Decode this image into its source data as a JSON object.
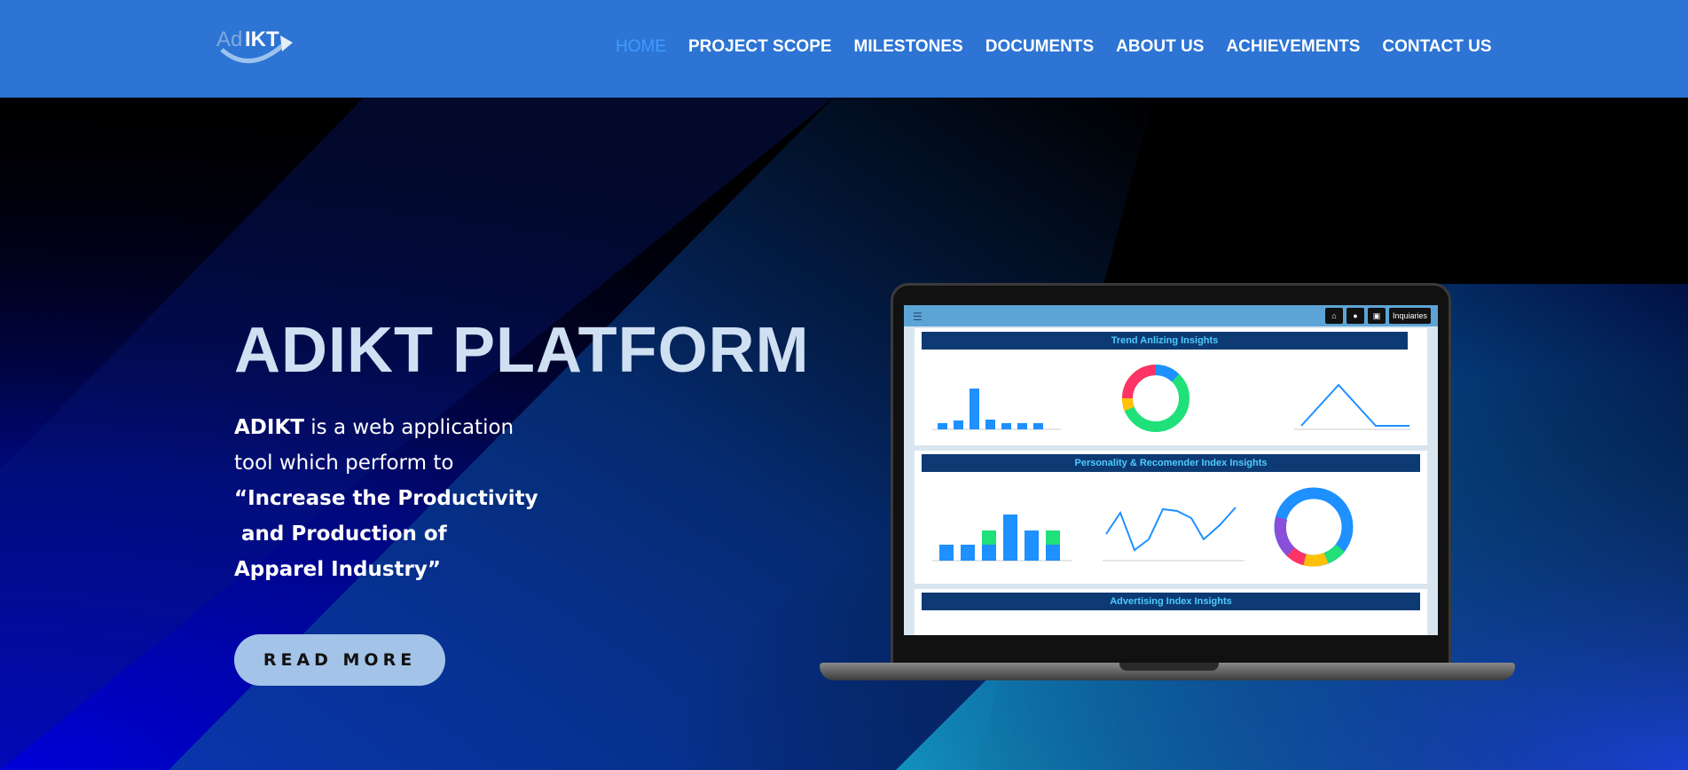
{
  "header": {
    "logo_text": "AdIKT",
    "nav": [
      {
        "label": "HOME",
        "active": true
      },
      {
        "label": "PROJECT SCOPE",
        "active": false
      },
      {
        "label": "MILESTONES",
        "active": false
      },
      {
        "label": "DOCUMENTS",
        "active": false
      },
      {
        "label": "ABOUT US",
        "active": false
      },
      {
        "label": "ACHIEVEMENTS",
        "active": false
      },
      {
        "label": "CONTACT US",
        "active": false
      }
    ]
  },
  "hero": {
    "title": "ADIKT PLATFORM",
    "intro_bold": "ADIKT",
    "intro_line1": " is a web application",
    "intro_line2": "tool which perform to",
    "quote_line1": "“Increase the Productivity",
    "quote_line2": " and Production of",
    "quote_line3": "Apparel Industry”",
    "button_label": "READ MORE"
  },
  "laptop_screen": {
    "toolbar_button": "Inquiaries",
    "panel1_title": "Trend Anlizing Insights",
    "panel2_title": "Personality & Recomender Index Insights",
    "panel3_title": "Advertising Index Insights"
  },
  "colors": {
    "header_bg": "#2d74d4",
    "nav_active": "#3d9bff",
    "title": "#cfe0f3",
    "button_bg": "#a3c3e8"
  }
}
